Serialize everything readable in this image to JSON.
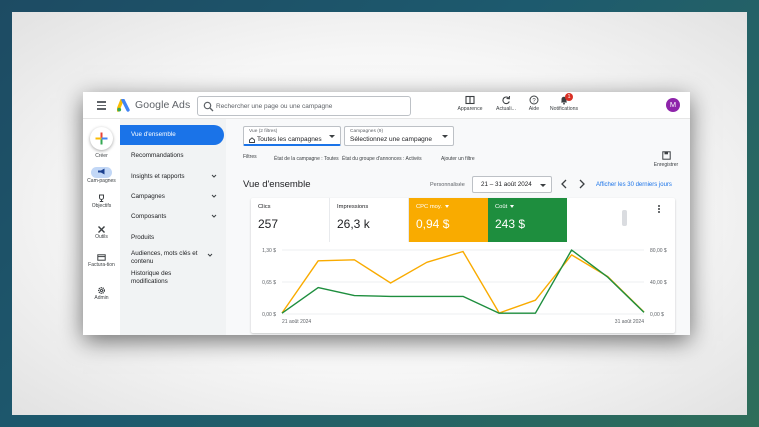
{
  "app": {
    "brand": "Google Ads",
    "avatar_initial": "M",
    "accent": "#1a73e8"
  },
  "search": {
    "placeholder": "Rechercher une page ou une campagne"
  },
  "toolbar": {
    "appearance": "Apparence",
    "refresh": "Actuali...",
    "help": "Aide",
    "notifications": "Notifications",
    "notifications_count": "1"
  },
  "rail": {
    "create": "Créer",
    "campaigns": "Cam-pagnes",
    "goals": "Objectifs",
    "tools": "Outils",
    "billing": "Factura-tion",
    "admin": "Admin"
  },
  "nav": {
    "items": [
      {
        "label": "Vue d'ensemble",
        "active": true
      },
      {
        "label": "Recommandations"
      },
      {
        "label": "Insights et rapports",
        "chevron": true
      },
      {
        "label": "Campagnes",
        "chevron": true
      },
      {
        "label": "Composants",
        "chevron": true
      },
      {
        "label": "Produits"
      },
      {
        "label": "Audiences, mots clés et contenu",
        "chevron": true
      },
      {
        "label": "Historique des modifications"
      }
    ]
  },
  "filters": {
    "view_caption": "Vue (2 filtres)",
    "view_value": "Toutes les campagnes",
    "campaigns_caption": "Campagnes (9)",
    "campaigns_value": "Sélectionnez une campagne",
    "label": "Filtres",
    "filter_1": "État de la campagne : Toutes",
    "filter_2": "État du groupe d'annonces : Activés",
    "add_filter": "Ajouter un filtre",
    "save": "Enregistrer"
  },
  "overview": {
    "title": "Vue d'ensemble",
    "custom": "Personnalisée",
    "date_range": "21 – 31 août 2024",
    "show_30_days": "Afficher les 30 derniers jours"
  },
  "kpis": [
    {
      "label": "Clics",
      "value": "257"
    },
    {
      "label": "Impressions",
      "value": "26,3 k"
    },
    {
      "label": "CPC moy.",
      "value": "0,94 $",
      "color": "#f9ab00"
    },
    {
      "label": "Coût",
      "value": "243 $",
      "color": "#1e8e3e"
    }
  ],
  "chart_data": {
    "type": "line",
    "x": [
      "21 août 2024",
      "",
      "",
      "",
      "",
      "",
      "",
      "",
      "",
      "",
      "31 août 2024"
    ],
    "left_axis": {
      "ticks": [
        "1,30 $",
        "0,65 $",
        "0,00 $"
      ],
      "range": [
        0,
        1.3
      ]
    },
    "right_axis": {
      "ticks": [
        "80,00 $",
        "40,00 $",
        "0,00 $"
      ],
      "range": [
        0,
        80
      ]
    },
    "series": [
      {
        "name": "CPC moy.",
        "color": "#f9ab00",
        "axis": "left",
        "values": [
          0.02,
          1.08,
          1.1,
          0.63,
          1.05,
          1.27,
          0.02,
          0.28,
          1.2,
          0.76,
          0.04
        ]
      },
      {
        "name": "Coût",
        "color": "#1e8e3e",
        "axis": "right",
        "values": [
          1,
          33,
          23,
          22,
          22,
          22,
          1,
          1,
          80,
          46,
          2
        ]
      }
    ],
    "grid": true,
    "legend": "none"
  }
}
